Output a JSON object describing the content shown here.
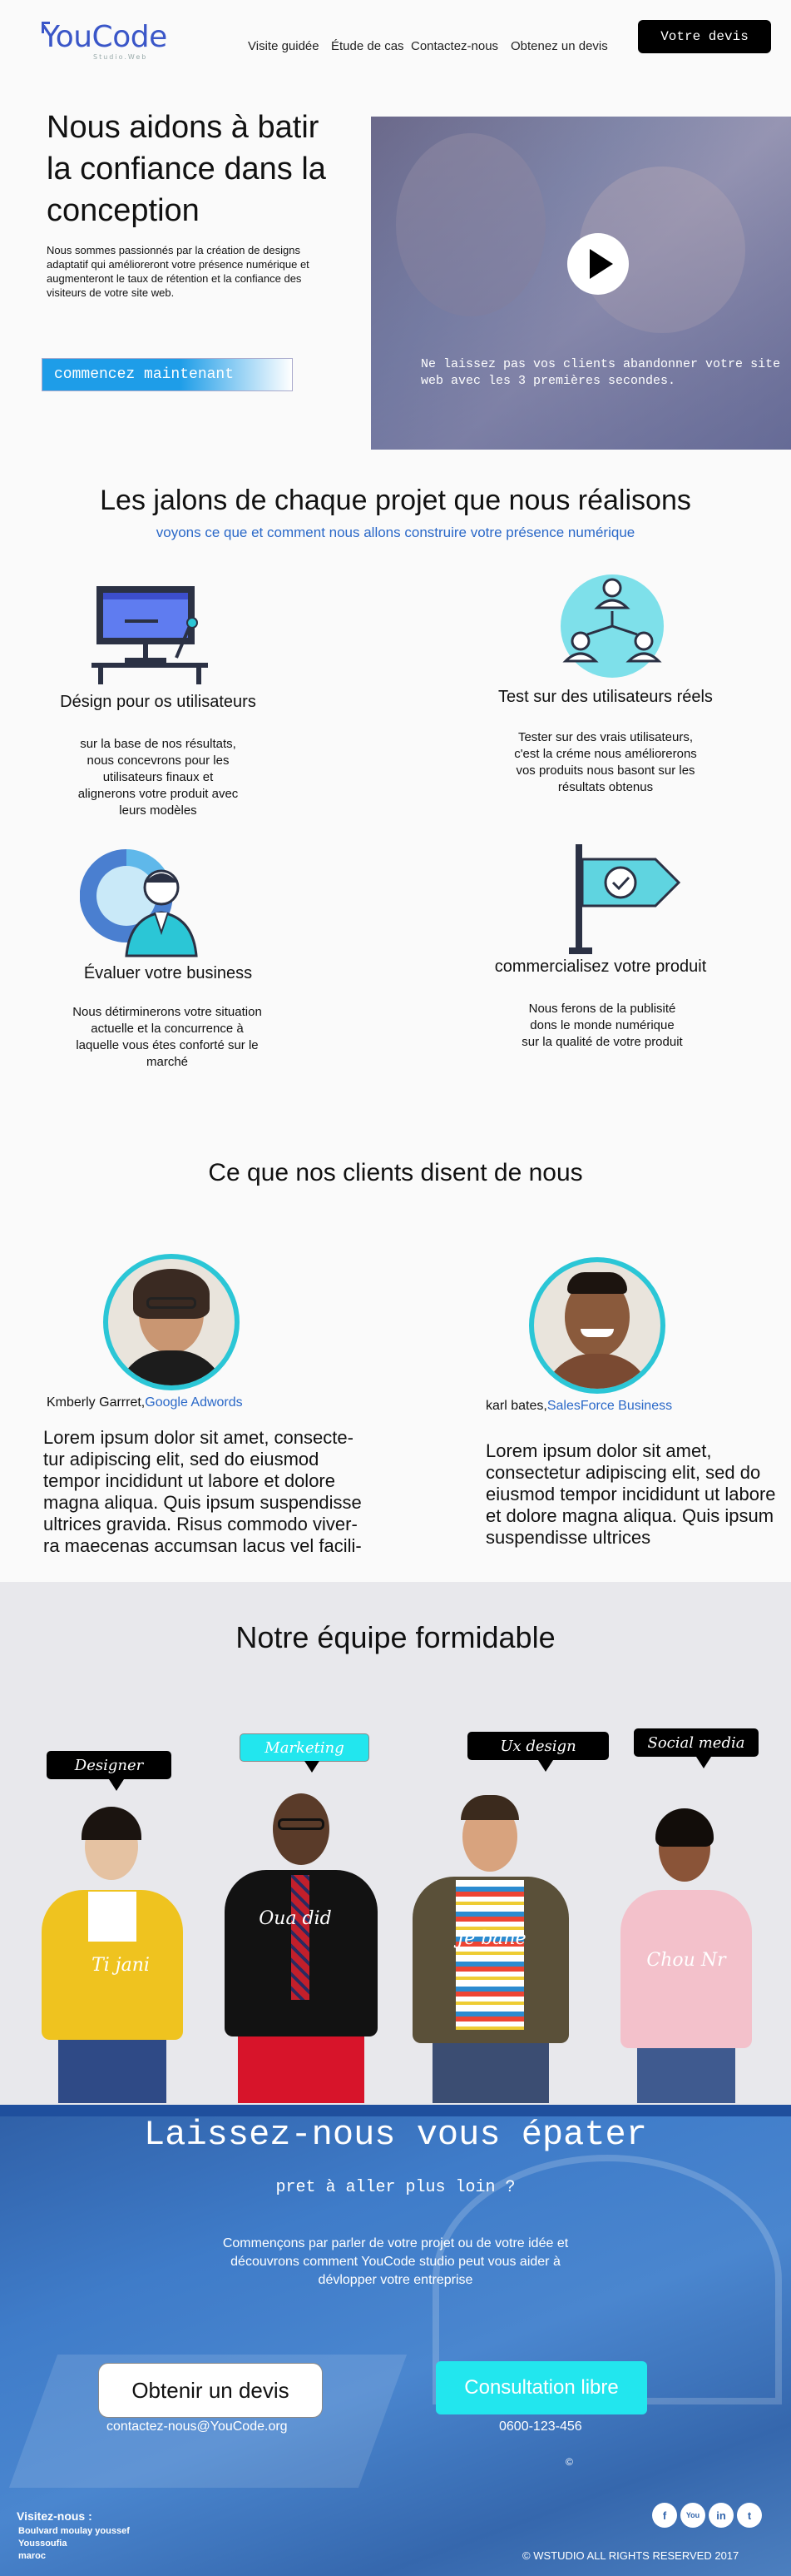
{
  "header": {
    "logo": "YouCode",
    "logo_tagline": "Studio.Web",
    "nav": [
      "Visite guidée",
      "Étude de cas",
      "Contactez-nous",
      "Obtenez un devis"
    ],
    "cta": "Votre devis"
  },
  "hero": {
    "title": "Nous aidons à batir la confiance dans la conception",
    "description": "Nous sommes passionnés par la création de designs adaptatif qui amélioreront votre présence numérique et augmenteront le taux de rétention et la confiance des visiteurs de votre site web.",
    "start_button": "commencez maintenant",
    "video_text": "Ne laissez pas vos clients abandonner votre site web avec les 3 premières secondes."
  },
  "milestones": {
    "title": "Les jalons de chaque projet que nous réalisons",
    "subtitle": "voyons ce que et comment nous allons construire votre présence numérique",
    "steps": [
      {
        "title": "Désign pour os utilisateurs",
        "desc": "sur la base de nos résultats, nous concevrons pour les utilisateurs finaux et alignerons votre produit avec leurs modèles"
      },
      {
        "title": "Test sur des utilisateurs réels",
        "desc": "Tester sur des vrais utilisateurs, c'est la créme nous améliorerons vos produits nous basont sur les résultats obtenus"
      },
      {
        "title": "Évaluer votre business",
        "desc": "Nous détirminerons votre situation actuelle et la concurrence à laquelle vous étes conforté sur le marché"
      },
      {
        "title": "commercialisez votre produit",
        "desc": "Nous ferons de la publisité dons le monde numérique sur la qualité de votre produit"
      }
    ]
  },
  "testimonials": {
    "title": "Ce que nos clients disent de nous",
    "items": [
      {
        "name": "Kmberly Garrret,",
        "company": "Google Adwords",
        "quote": "Lorem ipsum dolor sit amet, consecte-tur adipiscing elit, sed do eiusmod tempor incididunt ut labore et dolore magna aliqua. Quis ipsum suspendisse ultrices gravida. Risus commodo viver-ra maecenas accumsan lacus vel facili-"
      },
      {
        "name": "karl bates,",
        "company": "SalesForce Business",
        "quote": "Lorem ipsum dolor sit amet, consectetur adipiscing elit, sed do eiusmod tempor incididunt ut labore et dolore magna aliqua. Quis ipsum suspendisse ultrices"
      }
    ]
  },
  "team": {
    "title": "Notre équipe formidable",
    "members": [
      {
        "role": "Designer",
        "name": "Ti jani"
      },
      {
        "role": "Marketing",
        "name": "Oua did"
      },
      {
        "role": "Ux design",
        "name": "Je bane"
      },
      {
        "role": "Social media",
        "name": "Chou Nr"
      }
    ]
  },
  "cta": {
    "title": "Laissez-nous vous épater",
    "subtitle": "pret à aller plus loin ?",
    "description": "Commençons par parler de votre projet ou de votre idée et découvrons comment YouCode studio peut vous aider à dévlopper votre entreprise",
    "quote_button": "Obtenir un devis",
    "consult_button": "Consultation libre",
    "email": "contactez-nous@YouCode.org",
    "phone": "0600-123-456",
    "copy_symbol": "©"
  },
  "footer": {
    "visit_label": "Visitez-nous :",
    "address": [
      "Boulvard moulay youssef",
      "Youssoufia",
      "maroc"
    ],
    "social": [
      "f",
      "You",
      "in",
      "t"
    ],
    "rights": "© WSTUDIO ALL RIGHTS RESERVED 2017"
  },
  "colors": {
    "accent_blue": "#2a68c8",
    "cyan": "#2bc6d6",
    "dark": "#000000"
  }
}
